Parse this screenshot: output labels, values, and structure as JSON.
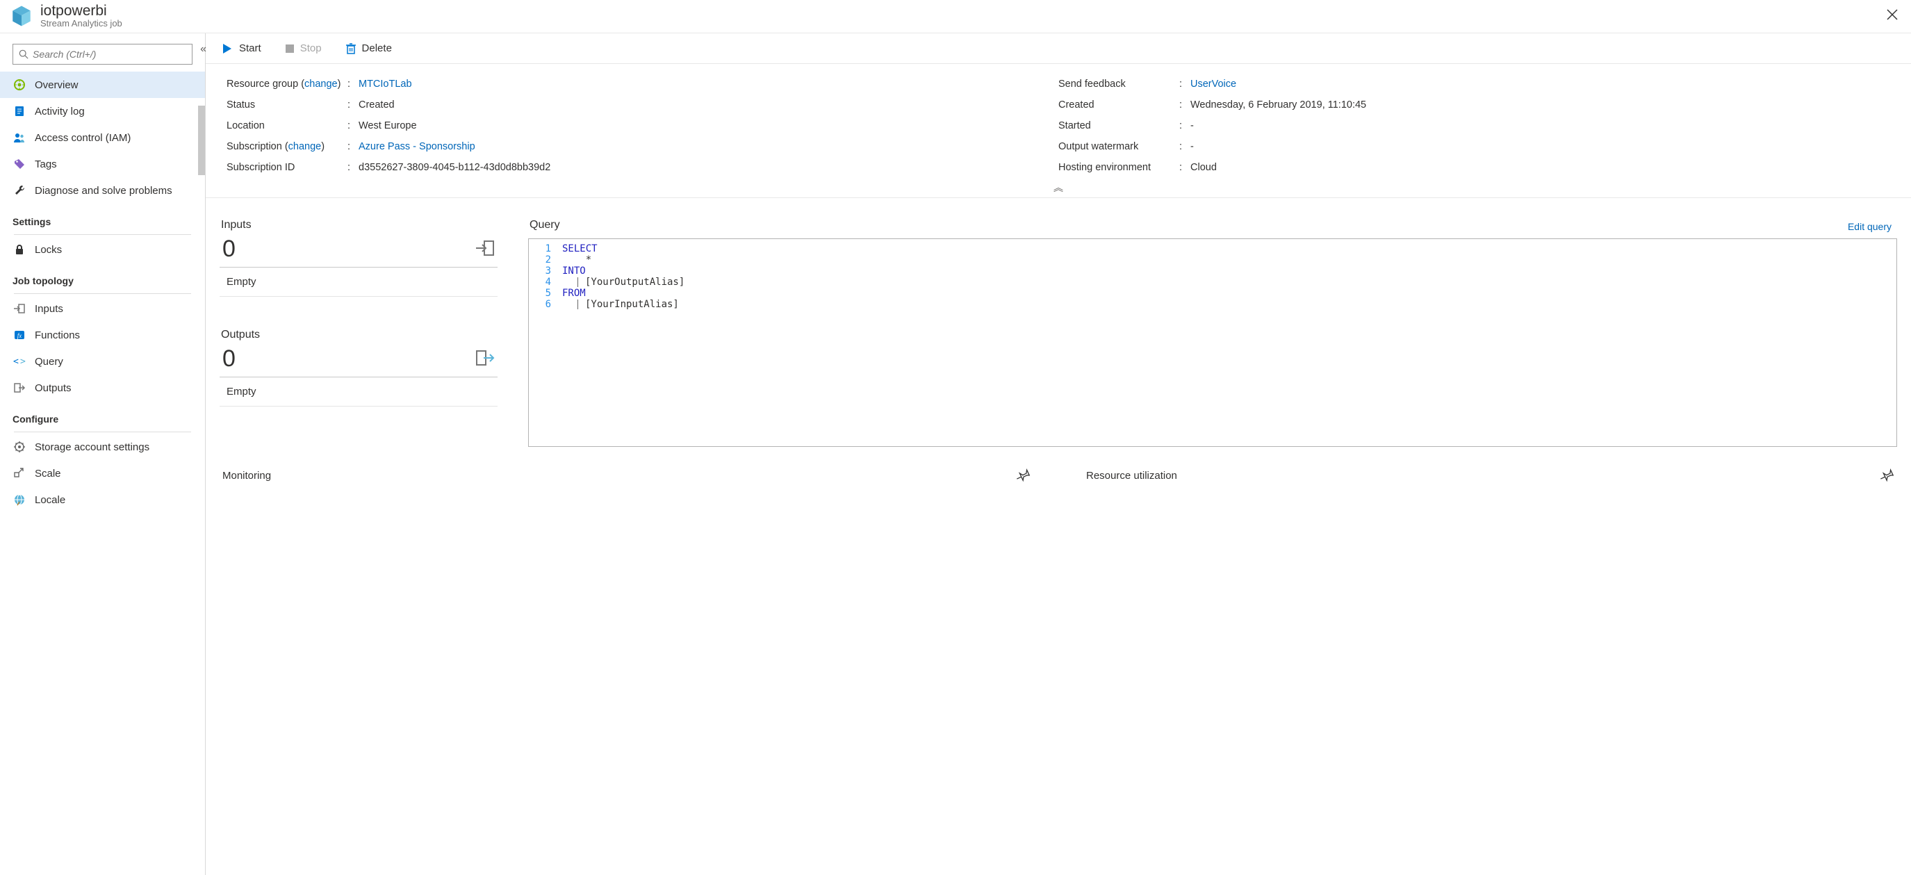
{
  "header": {
    "title": "iotpowerbi",
    "subtitle": "Stream Analytics job"
  },
  "sidebar": {
    "search_placeholder": "Search (Ctrl+/)",
    "top_items": [
      {
        "icon": "gear-green",
        "label": "Overview",
        "active": true
      },
      {
        "icon": "activity",
        "label": "Activity log"
      },
      {
        "icon": "people",
        "label": "Access control (IAM)"
      },
      {
        "icon": "tag",
        "label": "Tags"
      },
      {
        "icon": "wrench",
        "label": "Diagnose and solve problems"
      }
    ],
    "sections": [
      {
        "title": "Settings",
        "items": [
          {
            "icon": "lock",
            "label": "Locks"
          }
        ]
      },
      {
        "title": "Job topology",
        "items": [
          {
            "icon": "input",
            "label": "Inputs"
          },
          {
            "icon": "function",
            "label": "Functions"
          },
          {
            "icon": "query",
            "label": "Query"
          },
          {
            "icon": "output",
            "label": "Outputs"
          }
        ]
      },
      {
        "title": "Configure",
        "items": [
          {
            "icon": "storage",
            "label": "Storage account settings"
          },
          {
            "icon": "scale",
            "label": "Scale"
          },
          {
            "icon": "locale",
            "label": "Locale"
          }
        ]
      }
    ]
  },
  "toolbar": {
    "start": "Start",
    "stop": "Stop",
    "delete": "Delete"
  },
  "props_left": {
    "resource_group_label": "Resource group",
    "change_link": "change",
    "resource_group_value": "MTCIoTLab",
    "status_label": "Status",
    "status_value": "Created",
    "location_label": "Location",
    "location_value": "West Europe",
    "subscription_label": "Subscription",
    "subscription_value": "Azure Pass - Sponsorship",
    "subscription_id_label": "Subscription ID",
    "subscription_id_value": "d3552627-3809-4045-b112-43d0d8bb39d2"
  },
  "props_right": {
    "feedback_label": "Send feedback",
    "feedback_value": "UserVoice",
    "created_label": "Created",
    "created_value": "Wednesday, 6 February 2019, 11:10:45",
    "started_label": "Started",
    "started_value": "-",
    "watermark_label": "Output watermark",
    "watermark_value": "-",
    "hosting_label": "Hosting environment",
    "hosting_value": "Cloud"
  },
  "io": {
    "inputs_title": "Inputs",
    "inputs_count": "0",
    "inputs_empty": "Empty",
    "outputs_title": "Outputs",
    "outputs_count": "0",
    "outputs_empty": "Empty"
  },
  "query": {
    "title": "Query",
    "edit": "Edit query",
    "lines": [
      "1",
      "2",
      "3",
      "4",
      "5",
      "6"
    ],
    "kw1": "SELECT",
    "star": "*",
    "kw2": "INTO",
    "out": "[YourOutputAlias]",
    "kw3": "FROM",
    "in": "[YourInputAlias]"
  },
  "charts": {
    "monitoring": "Monitoring",
    "resource": "Resource utilization"
  }
}
